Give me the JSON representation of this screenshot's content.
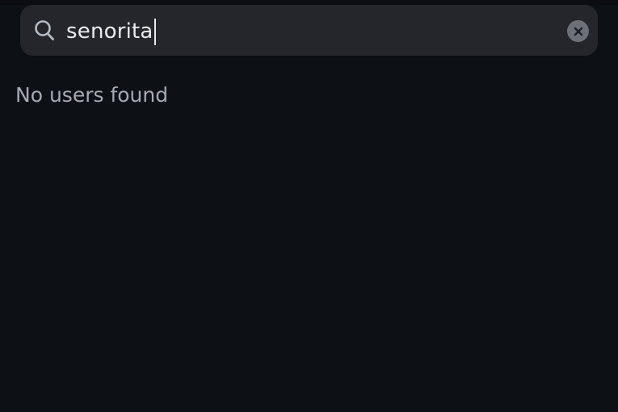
{
  "search": {
    "query": "senorita",
    "search_icon": "search-icon",
    "clear_icon": "clear-icon"
  },
  "results": {
    "empty_message": "No users found"
  },
  "colors": {
    "background": "#0d1015",
    "search_bar": "#24262b",
    "query_text": "#e9ebee",
    "message_text": "#a5abb4",
    "clear_button": "#6d7077"
  }
}
